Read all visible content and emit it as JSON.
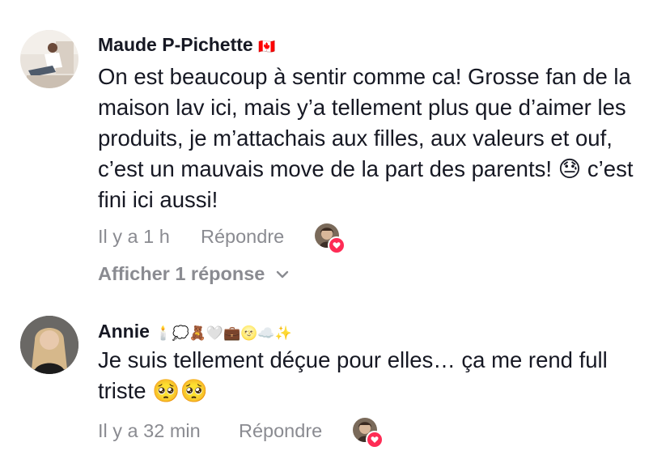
{
  "comments": [
    {
      "author": "Maude P-Pichette",
      "author_badge": "🇨🇦",
      "text": "On est beaucoup à sentir comme ca! Grosse fan de la maison lav ici, mais y’a tellement plus que d’aimer les produits, je m’attachais aux filles, aux valeurs et ouf, c’est un mauvais move de la part des parents! 😓 c’est fini ici aussi!",
      "time": "Il y a 1 h",
      "reply_label": "Répondre",
      "show_replies_label": "Afficher 1 réponse"
    },
    {
      "author": "Annie",
      "author_badge": "🕯️💭🧸🤍💼🌝☁️✨",
      "text": "Je suis tellement déçue pour elles… ça me rend full triste 🥺🥺",
      "time": "Il y a 32 min",
      "reply_label": "Répondre"
    }
  ],
  "colors": {
    "text": "#161823",
    "muted": "#8a8b91",
    "like_heart": "#fe2c55"
  },
  "icons": [
    "chevron-down-icon",
    "heart-icon"
  ]
}
